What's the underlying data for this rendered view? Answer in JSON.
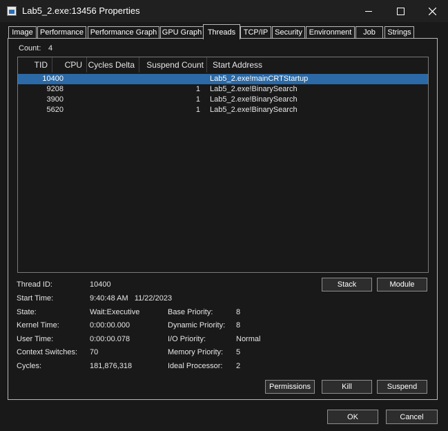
{
  "window": {
    "title": "Lab5_2.exe:13456 Properties",
    "minimize": "—",
    "maximize": "☐",
    "close": "✕"
  },
  "tabs": [
    "Image",
    "Performance",
    "Performance Graph",
    "GPU Graph",
    "Threads",
    "TCP/IP",
    "Security",
    "Environment",
    "Job",
    "Strings"
  ],
  "active_tab": "Threads",
  "count": {
    "label": "Count:",
    "value": "4"
  },
  "columns": [
    "TID",
    "CPU",
    "Cycles Delta",
    "Suspend Count",
    "Start Address"
  ],
  "threads": [
    {
      "tid": "10400",
      "cpu": "",
      "cycles_delta": "",
      "suspend_count": "",
      "start_address": "Lab5_2.exe!mainCRTStartup",
      "selected": true
    },
    {
      "tid": "9208",
      "cpu": "",
      "cycles_delta": "",
      "suspend_count": "1",
      "start_address": "Lab5_2.exe!BinarySearch",
      "selected": false
    },
    {
      "tid": "3900",
      "cpu": "",
      "cycles_delta": "",
      "suspend_count": "1",
      "start_address": "Lab5_2.exe!BinarySearch",
      "selected": false
    },
    {
      "tid": "5620",
      "cpu": "",
      "cycles_delta": "",
      "suspend_count": "1",
      "start_address": "Lab5_2.exe!BinarySearch",
      "selected": false
    }
  ],
  "details": {
    "thread_id_label": "Thread ID:",
    "thread_id": "10400",
    "start_time_label": "Start Time:",
    "start_time": "9:40:48 AM   11/22/2023",
    "state_label": "State:",
    "state": "Wait:Executive",
    "kernel_time_label": "Kernel Time:",
    "kernel_time": "0:00:00.000",
    "user_time_label": "User Time:",
    "user_time": "0:00:00.078",
    "context_switches_label": "Context Switches:",
    "context_switches": "70",
    "cycles_label": "Cycles:",
    "cycles": "181,876,318",
    "base_priority_label": "Base Priority:",
    "base_priority": "8",
    "dynamic_priority_label": "Dynamic Priority:",
    "dynamic_priority": "8",
    "io_priority_label": "I/O Priority:",
    "io_priority": "Normal",
    "memory_priority_label": "Memory Priority:",
    "memory_priority": "5",
    "ideal_processor_label": "Ideal Processor:",
    "ideal_processor": "2"
  },
  "buttons": {
    "stack": "Stack",
    "module": "Module",
    "permissions": "Permissions",
    "kill": "Kill",
    "suspend": "Suspend",
    "ok": "OK",
    "cancel": "Cancel"
  },
  "colors": {
    "background": "#191919",
    "selection": "#2b6aa6",
    "border": "#b9b9b9"
  }
}
